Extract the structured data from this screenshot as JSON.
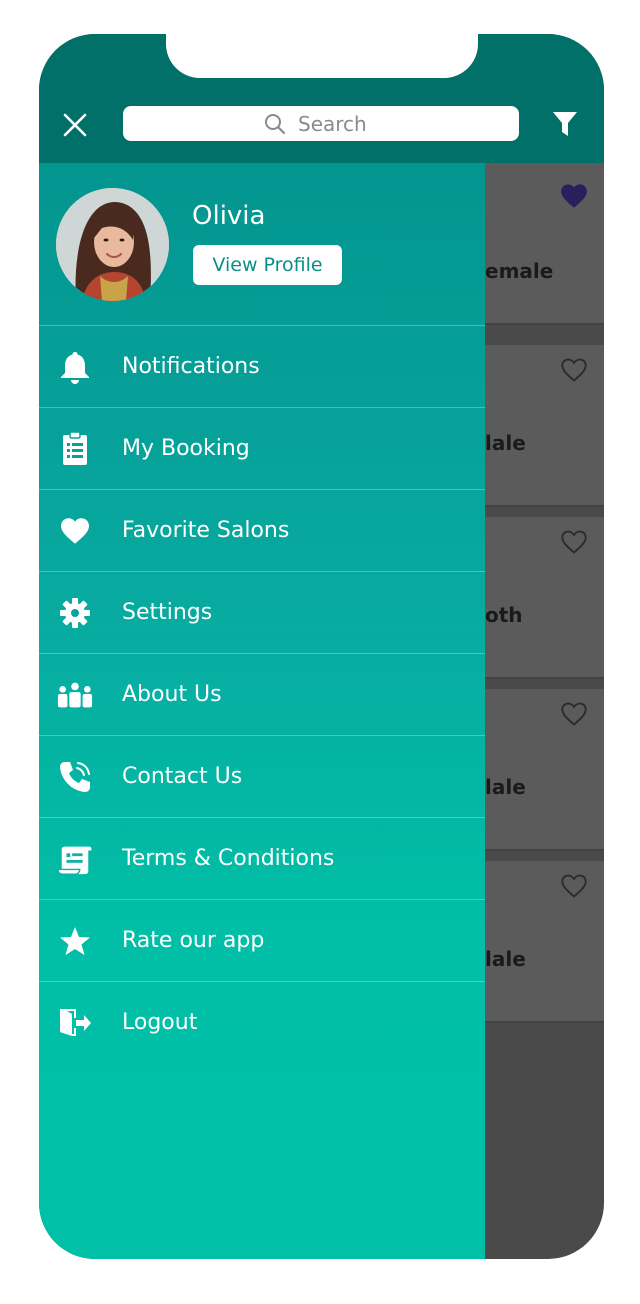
{
  "header": {
    "search_placeholder": "Search"
  },
  "profile": {
    "name": "Olivia",
    "view_profile_label": "View Profile"
  },
  "menu": {
    "items": [
      {
        "label": "Notifications",
        "icon": "bell-icon"
      },
      {
        "label": "My Booking",
        "icon": "clipboard-icon"
      },
      {
        "label": "Favorite Salons",
        "icon": "heart-icon"
      },
      {
        "label": "Settings",
        "icon": "gear-icon"
      },
      {
        "label": "About Us",
        "icon": "people-icon"
      },
      {
        "label": "Contact Us",
        "icon": "phone-icon"
      },
      {
        "label": "Terms & Conditions",
        "icon": "document-icon"
      },
      {
        "label": "Rate our app",
        "icon": "star-icon"
      },
      {
        "label": "Logout",
        "icon": "logout-icon"
      }
    ]
  },
  "background_list": {
    "cards": [
      {
        "gender_text": "emale",
        "favorited": true
      },
      {
        "gender_text": "lale",
        "favorited": false
      },
      {
        "gender_text": "oth",
        "favorited": false
      },
      {
        "gender_text": "lale",
        "favorited": false
      },
      {
        "gender_text": "lale",
        "favorited": false
      }
    ]
  },
  "colors": {
    "header": "#007068",
    "drawer_top": "#03958f",
    "drawer_bottom": "#00c0a8",
    "favorite_heart": "#2a1f5c"
  }
}
